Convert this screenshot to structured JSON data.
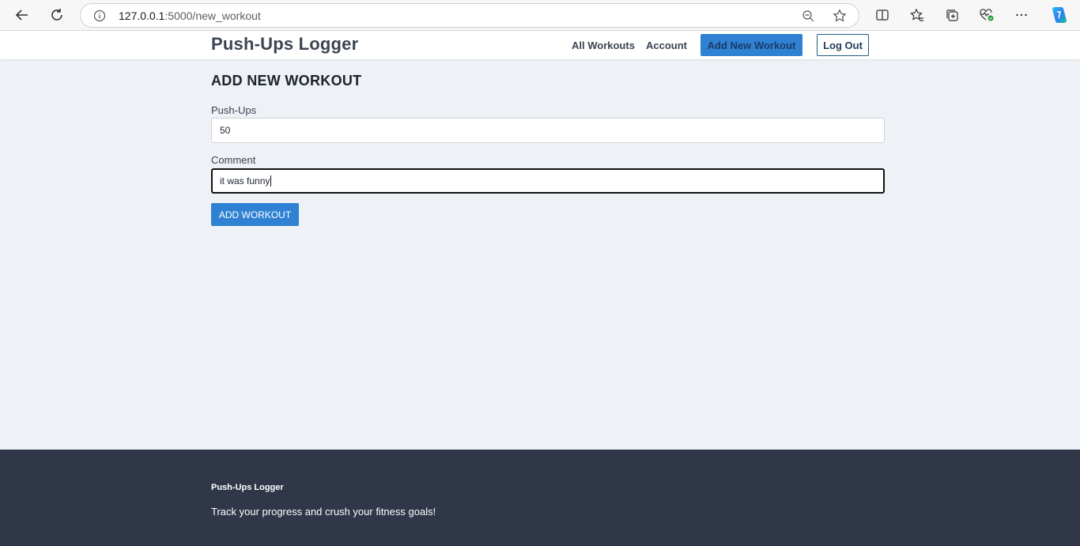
{
  "browser": {
    "url_host": "127.0.0.1",
    "url_path": ":5000/new_workout",
    "icons": [
      "back-icon",
      "reload-icon",
      "info-icon",
      "zoom-out-icon",
      "favorite-star-icon",
      "split-screen-icon",
      "favorites-icon",
      "collections-icon",
      "browser-essentials-icon",
      "more-icon",
      "copilot-icon"
    ]
  },
  "header": {
    "brand": "Push-Ups Logger",
    "nav": {
      "all_workouts": "All Workouts",
      "account": "Account",
      "add_new_workout": "Add New Workout",
      "log_out": "Log Out"
    }
  },
  "main": {
    "title": "ADD NEW WORKOUT",
    "pushups": {
      "label": "Push-Ups",
      "value": "50"
    },
    "comment": {
      "label": "Comment",
      "value": "it was funny"
    },
    "submit_label": "ADD WORKOUT"
  },
  "footer": {
    "brand": "Push-Ups Logger",
    "tagline": "Track your progress and crush your fitness goals!"
  },
  "colors": {
    "primary": "#2f82d3",
    "page_bg": "#eef1f5",
    "footer_bg": "#2f3748",
    "text_dark": "#3b4451"
  }
}
